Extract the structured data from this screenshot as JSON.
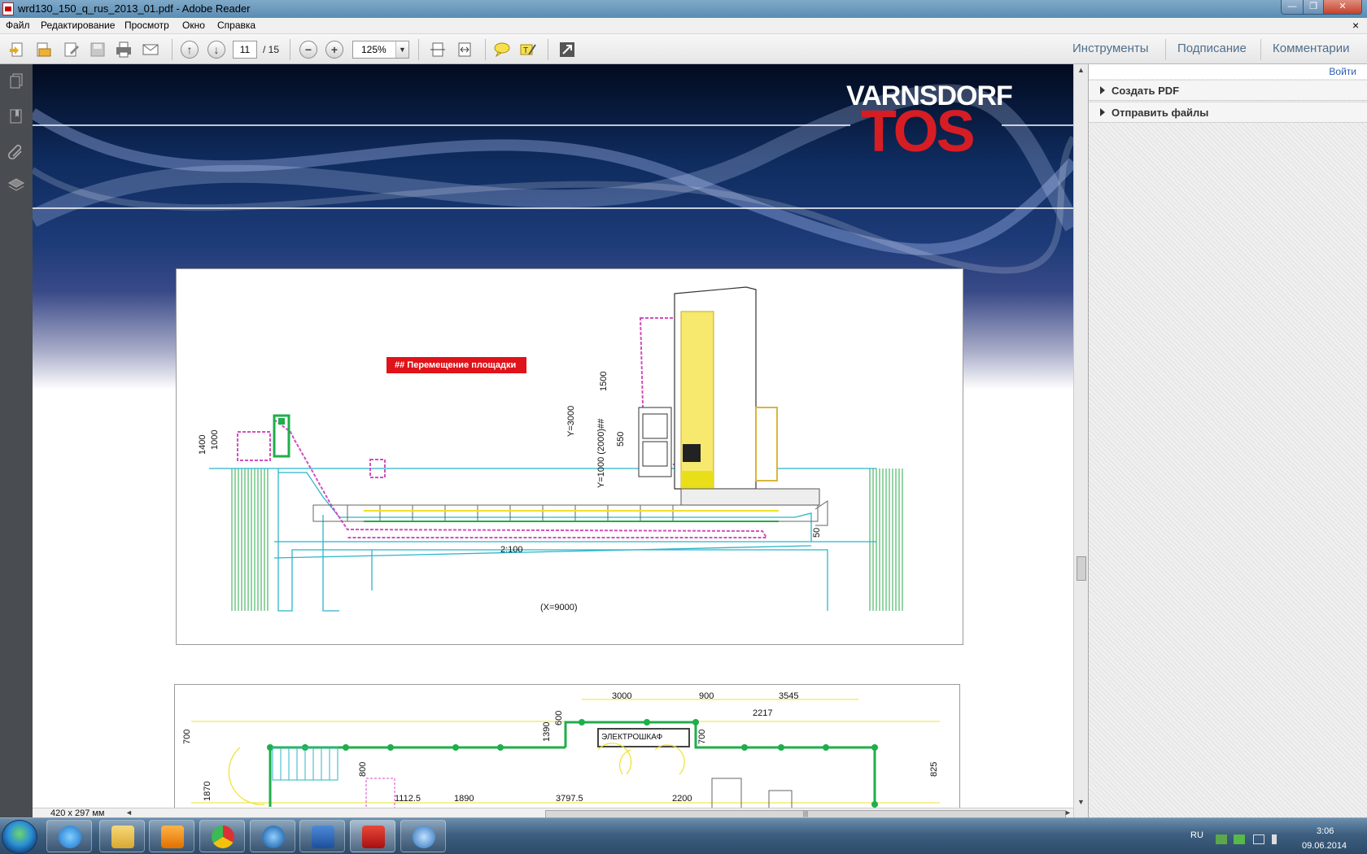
{
  "window": {
    "title": "wrd130_150_q_rus_2013_01.pdf - Adobe Reader",
    "min": "—",
    "max": "❐",
    "close": "✕"
  },
  "menu": {
    "items": [
      "Файл",
      "Редактирование",
      "Просмотр",
      "Окно",
      "Справка"
    ],
    "doc_close": "×"
  },
  "toolbar": {
    "page_current": "11",
    "page_total": "/ 15",
    "zoom": "125%",
    "right_tools": [
      "Инструменты",
      "Подписание",
      "Комментарии"
    ]
  },
  "right_panel": {
    "login": "Войти",
    "sections": [
      "Создать PDF",
      "Отправить файлы"
    ]
  },
  "document": {
    "brand_top": "VARNSDORF",
    "brand_main": "TOS",
    "label_red": "## Перемещение площадки",
    "fig1_dims": {
      "d1400": "1400",
      "d1000": "1000",
      "y3000": "Y=3000",
      "y1000": "Y=1000 (2000)##",
      "d1500": "1500",
      "d550": "550",
      "slope": "2:100",
      "x9000": "(X=9000)",
      "d50": "50"
    },
    "fig2_dims": {
      "d3000": "3000",
      "d900": "900",
      "d3545": "3545",
      "d2217": "2217",
      "d700a": "700",
      "d1390": "1390",
      "d600": "600",
      "d700b": "700",
      "d825": "825",
      "d800": "800",
      "d1870": "1870",
      "d1112": "1112.5",
      "d1890": "1890",
      "d3797": "3797.5",
      "d2200": "2200",
      "cabinet": "ЭЛЕКТРОШКАФ"
    },
    "page_size": "420 x 297 мм"
  },
  "taskbar": {
    "lang": "RU",
    "time": "3:06",
    "date": "09.06.2014"
  },
  "colors": {
    "accent_blue": "#4e6f8d",
    "brand_red": "#d61d24",
    "cyan_lines": "#2bb5c9",
    "magenta": "#d34fbf",
    "green": "#1fae4a",
    "yellow": "#f0e12a"
  }
}
